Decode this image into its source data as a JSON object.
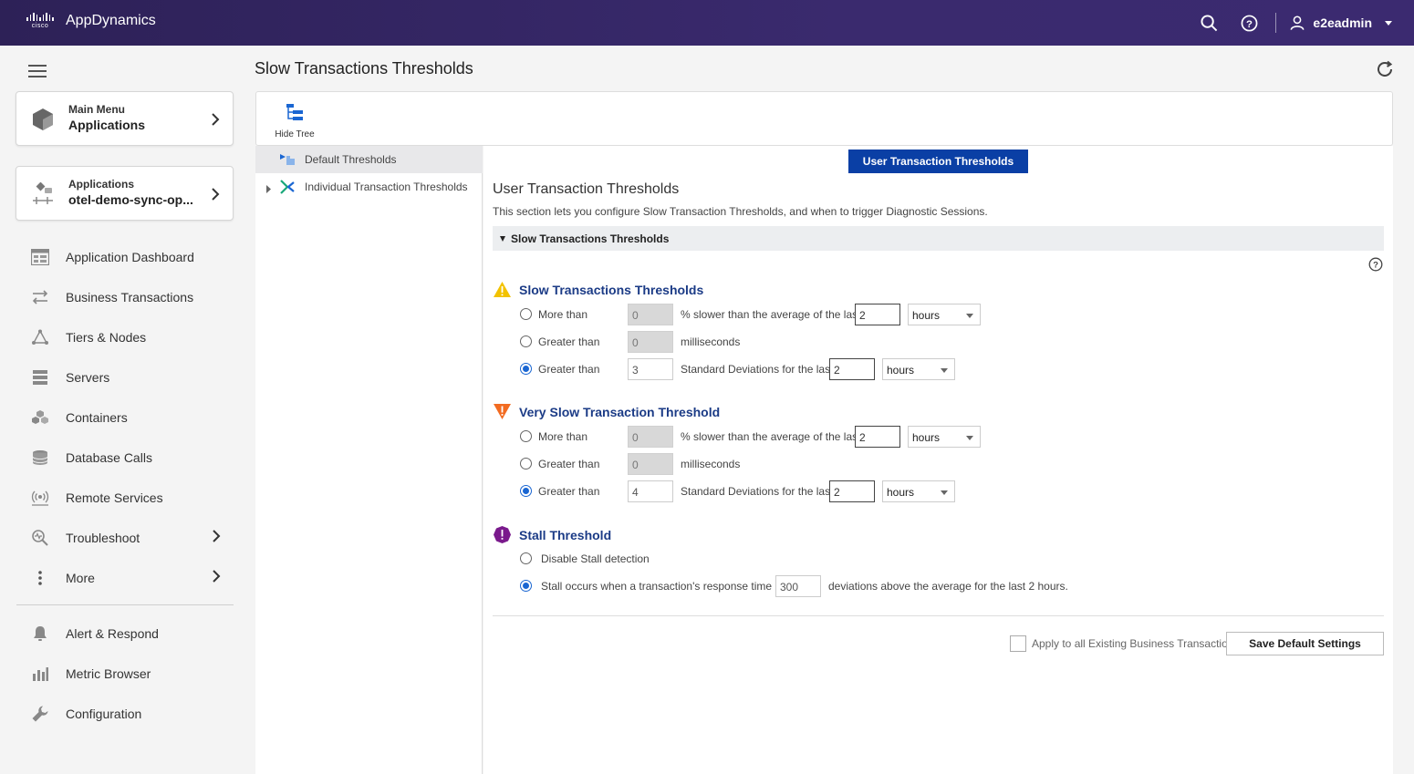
{
  "header": {
    "brand_logo_text": "cisco",
    "app_name": "AppDynamics",
    "username": "e2eadmin"
  },
  "sidebar": {
    "main_menu": {
      "small": "Main Menu",
      "big": "Applications"
    },
    "applications": {
      "small": "Applications",
      "big": "otel-demo-sync-op..."
    },
    "items": [
      {
        "label": "Application Dashboard",
        "icon": "dashboard-icon"
      },
      {
        "label": "Business Transactions",
        "icon": "transactions-icon"
      },
      {
        "label": "Tiers & Nodes",
        "icon": "tiers-icon"
      },
      {
        "label": "Servers",
        "icon": "servers-icon"
      },
      {
        "label": "Containers",
        "icon": "containers-icon"
      },
      {
        "label": "Database Calls",
        "icon": "database-icon"
      },
      {
        "label": "Remote Services",
        "icon": "remote-services-icon"
      },
      {
        "label": "Troubleshoot",
        "icon": "troubleshoot-icon"
      },
      {
        "label": "More",
        "icon": "more-icon"
      }
    ],
    "bottom_items": [
      {
        "label": "Alert & Respond",
        "icon": "bell-icon"
      },
      {
        "label": "Metric Browser",
        "icon": "bar-chart-icon"
      },
      {
        "label": "Configuration",
        "icon": "wrench-icon"
      }
    ]
  },
  "page": {
    "title": "Slow Transactions Thresholds",
    "hide_tree": "Hide Tree"
  },
  "tree": {
    "items": [
      {
        "label": "Default Thresholds"
      },
      {
        "label": "Individual Transaction Thresholds"
      }
    ]
  },
  "content": {
    "tab_label": "User Transaction Thresholds",
    "section_title": "User Transaction Thresholds",
    "section_desc": "This section lets you configure Slow Transaction Thresholds, and when to trigger Diagnostic Sessions.",
    "collapse_label": "Slow Transactions Thresholds",
    "slow": {
      "title": "Slow Transactions Thresholds",
      "rows": [
        {
          "label": "More than",
          "value": "0",
          "text": "% slower than the average of the last",
          "window": "2",
          "unit": "hours"
        },
        {
          "label": "Greater than",
          "value": "0",
          "text": "milliseconds"
        },
        {
          "label": "Greater than",
          "value": "3",
          "text": "Standard Deviations for the last",
          "window": "2",
          "unit": "hours"
        }
      ]
    },
    "very_slow": {
      "title": "Very Slow Transaction Threshold",
      "rows": [
        {
          "label": "More than",
          "value": "0",
          "text": "% slower than the average of the last",
          "window": "2",
          "unit": "hours"
        },
        {
          "label": "Greater than",
          "value": "0",
          "text": "milliseconds"
        },
        {
          "label": "Greater than",
          "value": "4",
          "text": "Standard Deviations for the last",
          "window": "2",
          "unit": "hours"
        }
      ]
    },
    "stall": {
      "title": "Stall Threshold",
      "disable_label": "Disable Stall detection",
      "occurs_label": "Stall occurs when a transaction's response time is",
      "occurs_value": "300",
      "occurs_suffix": "deviations above the average for the last 2 hours."
    },
    "apply_label": "Apply to all Existing Business Transactions",
    "save_label": "Save Default Settings"
  },
  "colors": {
    "header_bg": "#2d2157",
    "tab_button": "#0a3fa5",
    "group_title": "#1b3b86",
    "warning": "#f2c200",
    "critical": "#f26b21",
    "stall": "#7a1a8c",
    "radio_selected": "#1a66d2"
  }
}
